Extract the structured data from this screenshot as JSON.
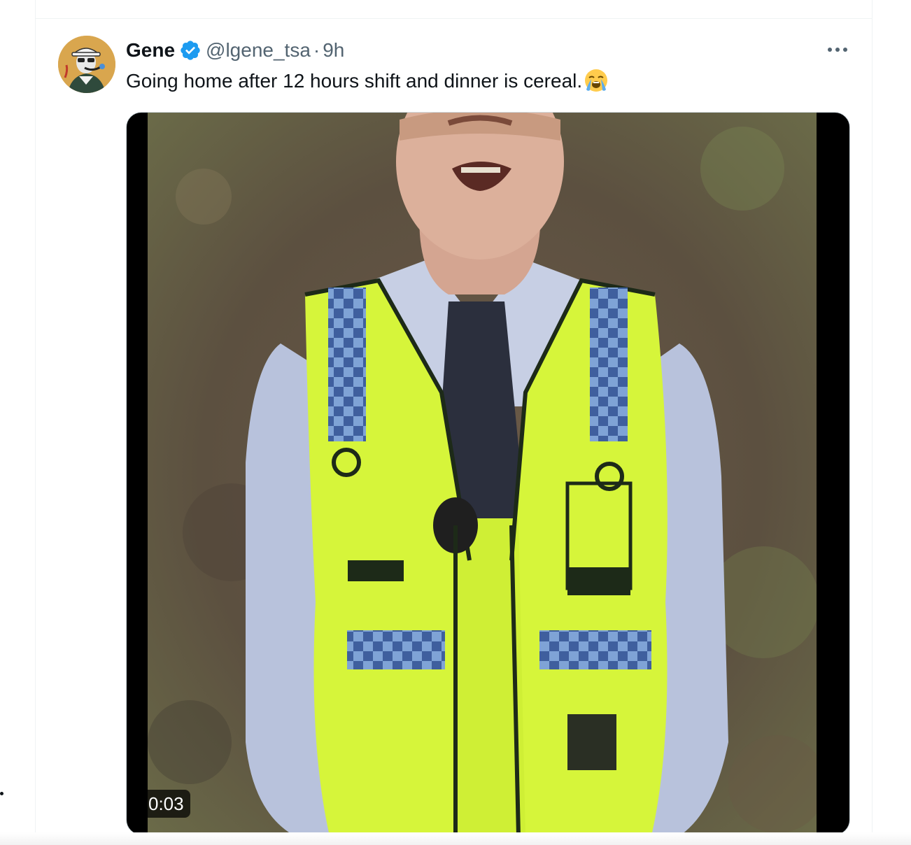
{
  "tweet": {
    "author": {
      "display_name": "Gene",
      "verified": true,
      "handle": "@lgene_tsa",
      "separator": "·",
      "time": "9h",
      "avatar_icon": "avatar-cartoon-icon"
    },
    "text": "Going home after 12 hours shift and dinner is cereal.",
    "emoji": "loudly-crying-face-icon",
    "more_icon": "more-options-icon",
    "media": {
      "type": "video",
      "duration": "0:03"
    }
  },
  "colors": {
    "verified": "#1d9bf0",
    "secondary_text": "#536471",
    "primary_text": "#0f1419",
    "vest": "#d6f53a",
    "vest_check": "#4a6fb0"
  }
}
